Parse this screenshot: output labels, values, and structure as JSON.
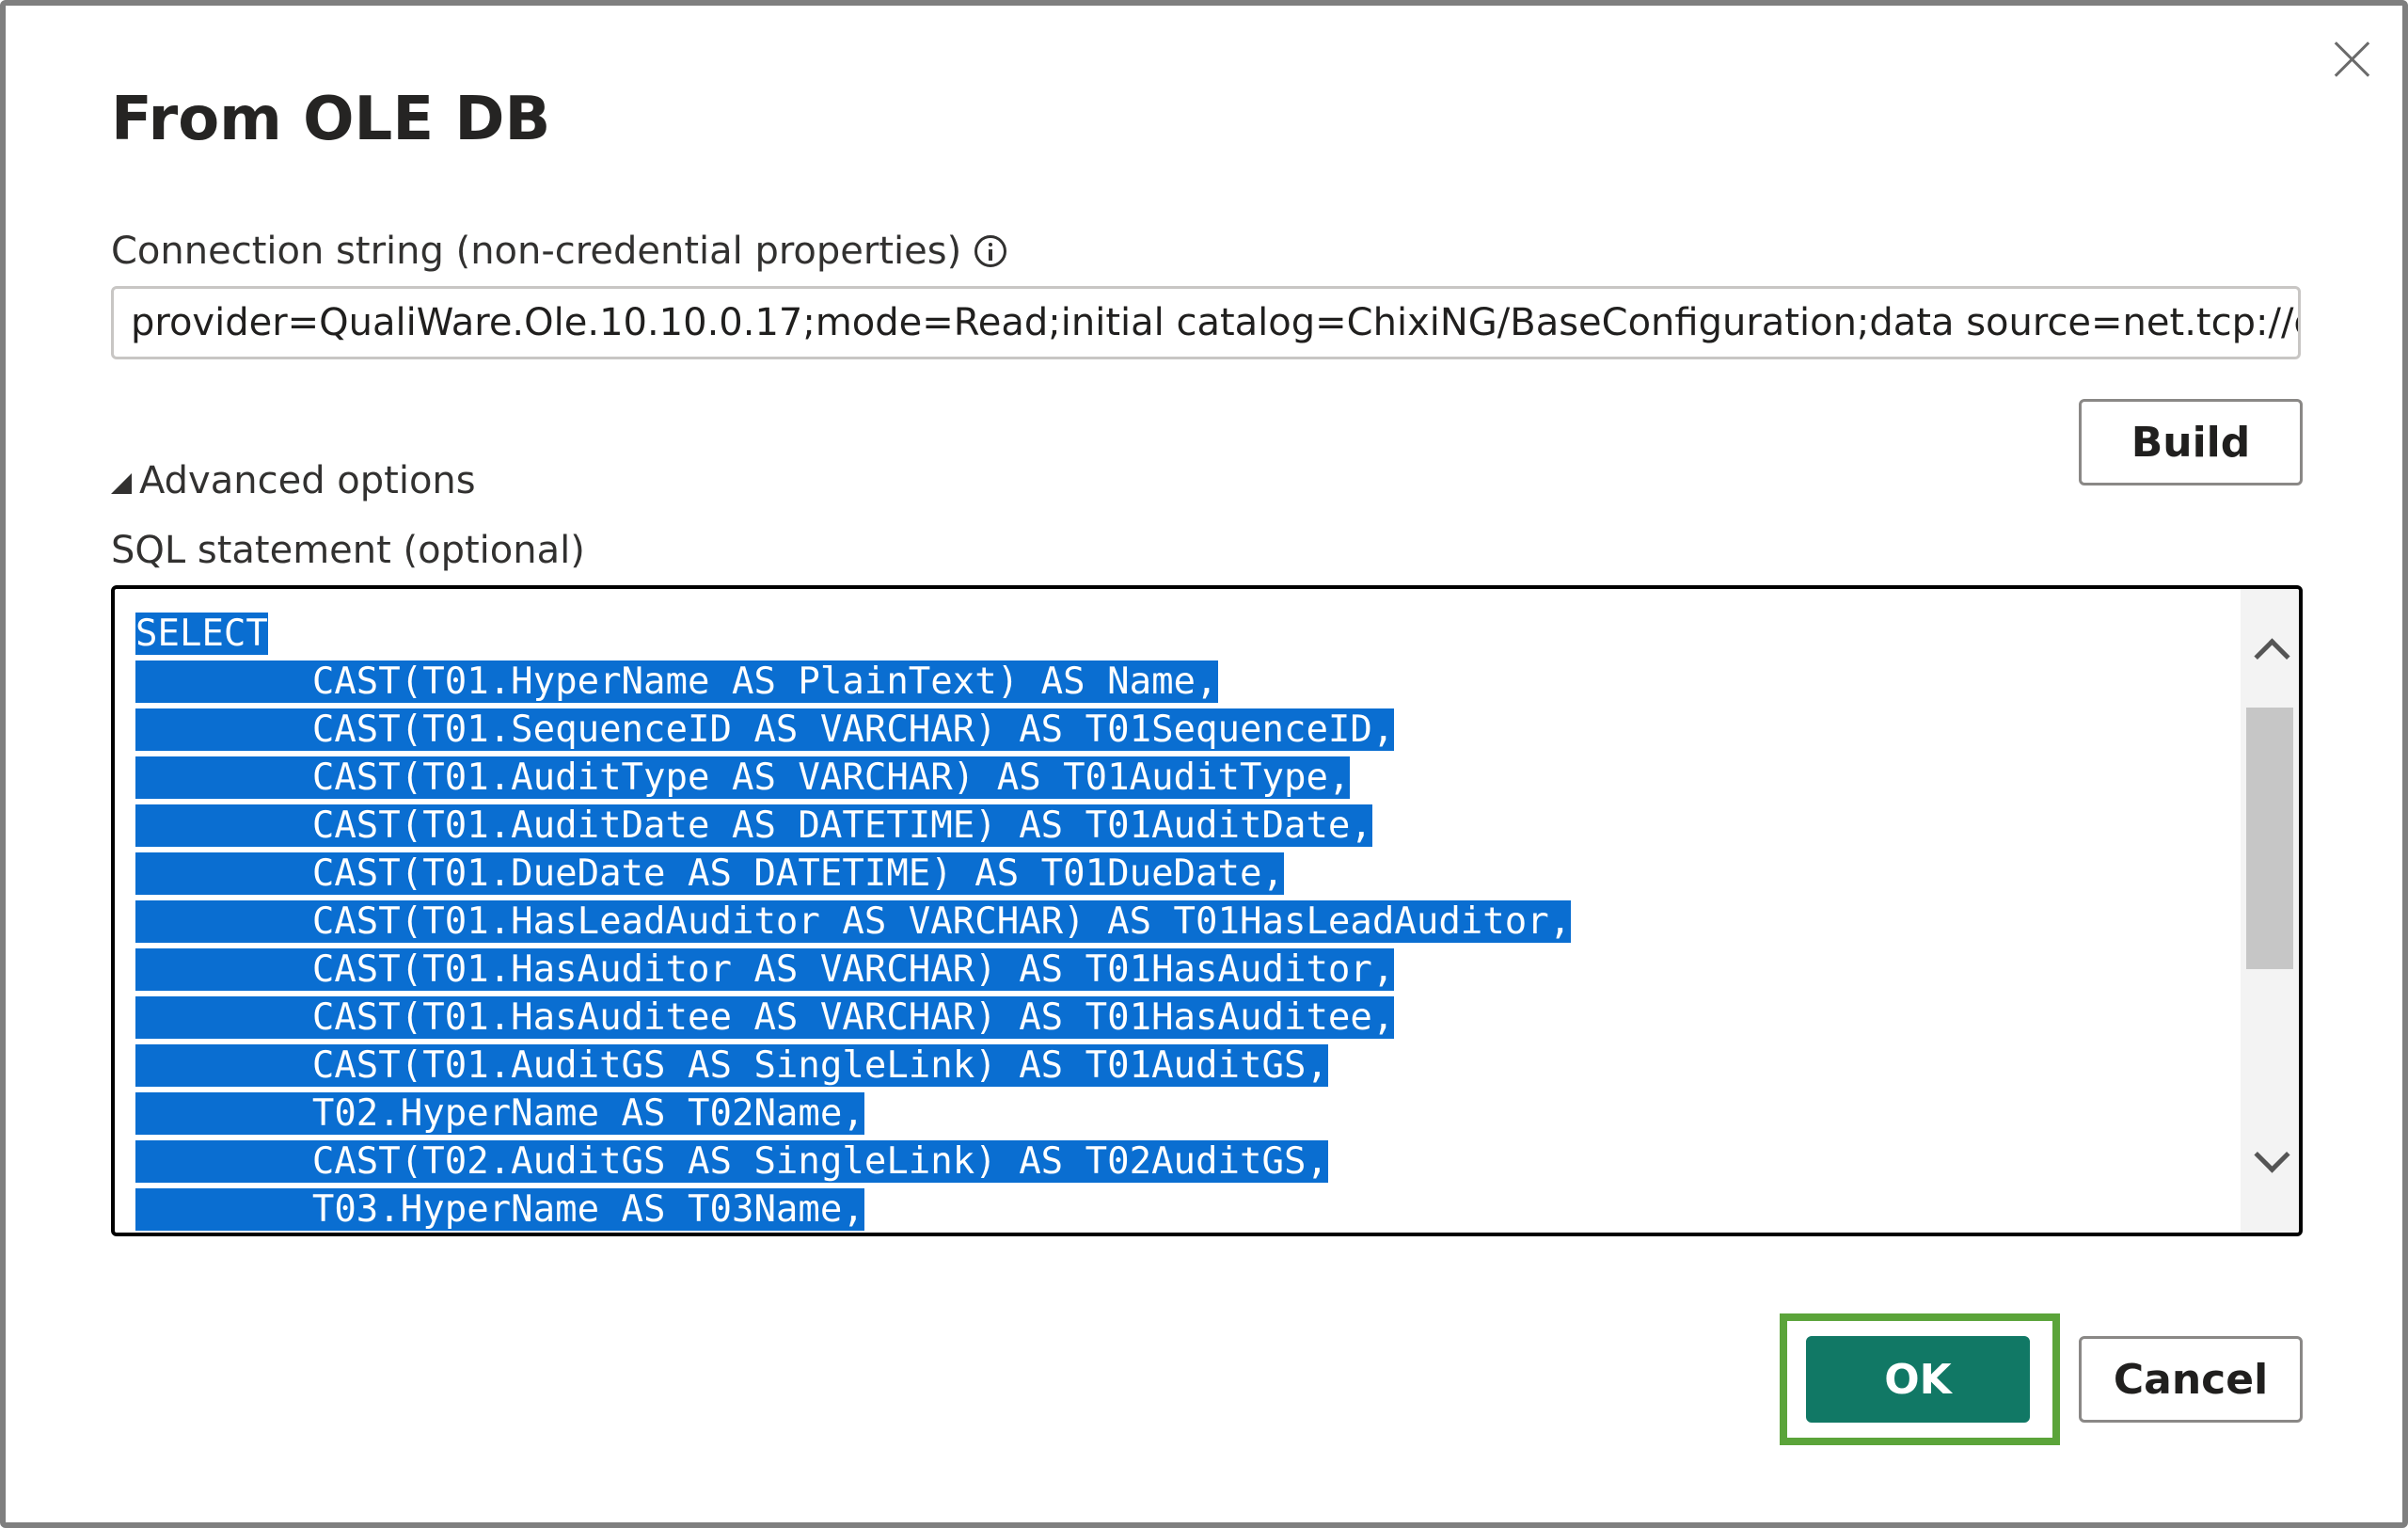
{
  "dialog": {
    "title": "From OLE DB",
    "close_icon": "close-icon"
  },
  "connection": {
    "label": "Connection string (non-credential properties)",
    "info_icon": "info-icon",
    "value": "provider=QualiWare.Ole.10.10.0.17;mode=Read;initial catalog=ChixiNG/BaseConfiguration;data source=net.tcp://curren"
  },
  "buttons": {
    "build": "Build",
    "ok": "OK",
    "cancel": "Cancel"
  },
  "advanced": {
    "label": "Advanced options",
    "toggle_icon": "triangle-expanded-icon"
  },
  "sql": {
    "label": "SQL statement (optional)",
    "lines": [
      "SELECT",
      "        CAST(T01.HyperName AS PlainText) AS Name,",
      "        CAST(T01.SequenceID AS VARCHAR) AS T01SequenceID,",
      "        CAST(T01.AuditType AS VARCHAR) AS T01AuditType,",
      "        CAST(T01.AuditDate AS DATETIME) AS T01AuditDate,",
      "        CAST(T01.DueDate AS DATETIME) AS T01DueDate,",
      "        CAST(T01.HasLeadAuditor AS VARCHAR) AS T01HasLeadAuditor,",
      "        CAST(T01.HasAuditor AS VARCHAR) AS T01HasAuditor,",
      "        CAST(T01.HasAuditee AS VARCHAR) AS T01HasAuditee,",
      "        CAST(T01.AuditGS AS SingleLink) AS T01AuditGS,",
      "        T02.HyperName AS T02Name,",
      "        CAST(T02.AuditGS AS SingleLink) AS T02AuditGS,",
      "        T03.HyperName AS T03Name,"
    ]
  },
  "colors": {
    "accent": "#117865",
    "highlight_border": "#5ba43a",
    "selection": "#0a6ed1"
  }
}
